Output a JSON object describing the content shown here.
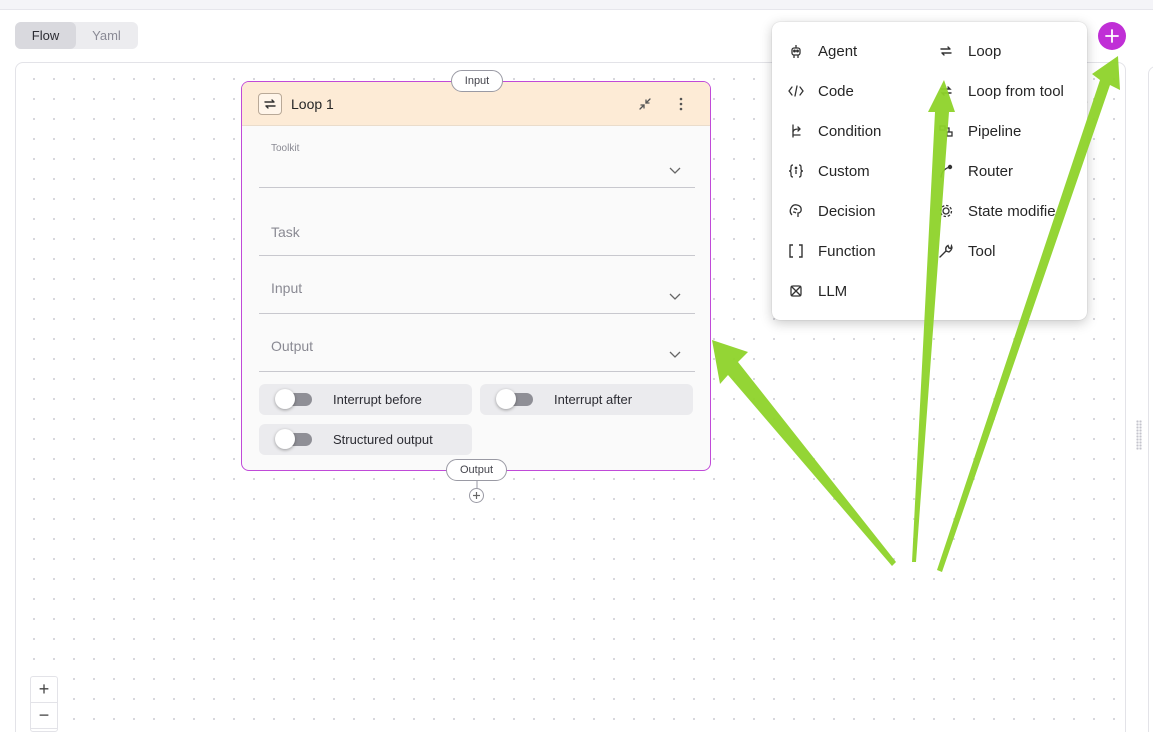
{
  "view_toggle": {
    "tabs": [
      "Flow",
      "Yaml"
    ],
    "active": "Flow"
  },
  "node": {
    "title": "Loop 1",
    "input_port": "Input",
    "output_port": "Output",
    "toolkit_label": "Toolkit",
    "task_label": "Task",
    "input_label": "Input",
    "output_label": "Output",
    "toggles": {
      "interrupt_before": "Interrupt before",
      "interrupt_after": "Interrupt after",
      "structured_output": "Structured output"
    }
  },
  "zoom": {
    "in": "+",
    "out": "−"
  },
  "menu": {
    "left": [
      {
        "label": "Agent",
        "icon": "robot-icon"
      },
      {
        "label": "Code",
        "icon": "code-icon"
      },
      {
        "label": "Condition",
        "icon": "branch-icon"
      },
      {
        "label": "Custom",
        "icon": "braces-icon"
      },
      {
        "label": "Decision",
        "icon": "brain-icon"
      },
      {
        "label": "Function",
        "icon": "brackets-icon"
      },
      {
        "label": "LLM",
        "icon": "llm-icon"
      }
    ],
    "right": [
      {
        "label": "Loop",
        "icon": "loop-icon"
      },
      {
        "label": "Loop from tool",
        "icon": "loop-tool-icon"
      },
      {
        "label": "Pipeline",
        "icon": "pipeline-icon"
      },
      {
        "label": "Router",
        "icon": "router-icon"
      },
      {
        "label": "State modifie",
        "icon": "gear-icon"
      },
      {
        "label": "Tool",
        "icon": "wrench-icon"
      }
    ]
  },
  "colors": {
    "accent": "#c02fd6",
    "node_border": "#c04ad8",
    "node_header": "#fdebd6",
    "annotation_arrow": "#8ed32a"
  }
}
